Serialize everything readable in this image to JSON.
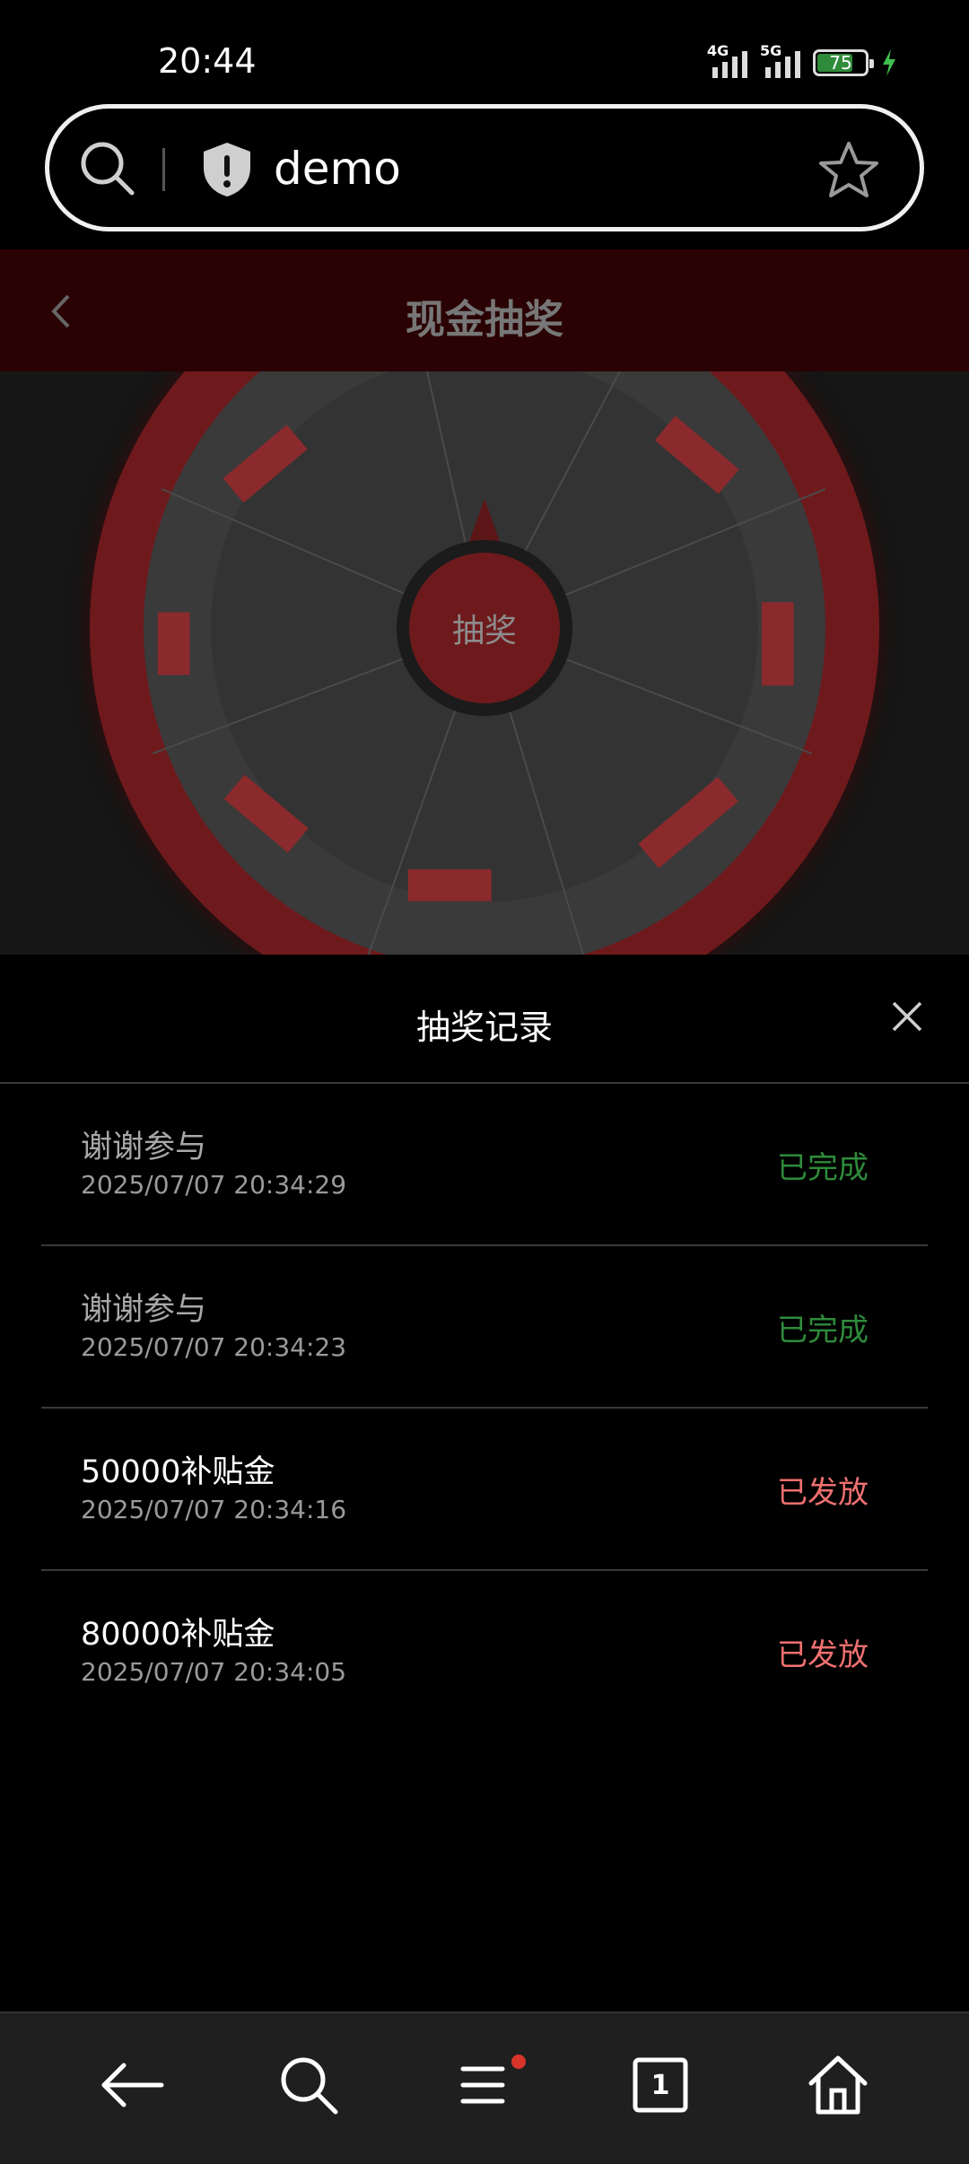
{
  "status_bar": {
    "time": "20:44",
    "network_1": "4G",
    "network_2": "5G",
    "battery": "75",
    "battery_color": "#2f8a3a"
  },
  "url_bar": {
    "domain": "demo",
    "icons": [
      "search-icon",
      "shield-warning-icon",
      "star-icon"
    ]
  },
  "page": {
    "title": "现金抽奖",
    "spin_button": "抽奖",
    "accent_color": "#6e1a1d"
  },
  "sheet": {
    "title": "抽奖记录",
    "records": [
      {
        "name": "谢谢参与",
        "time": "2025/07/07 20:34:29",
        "status": "已完成"
      },
      {
        "name": "谢谢参与",
        "time": "2025/07/07 20:34:23",
        "status": "已完成"
      },
      {
        "name": "50000补贴金",
        "time": "2025/07/07 20:34:16",
        "status": "已发放"
      },
      {
        "name": "80000补贴金",
        "time": "2025/07/07 20:34:05",
        "status": "已发放"
      }
    ],
    "colors": {
      "done": "#2e8b3a",
      "issued": "#f07070",
      "muted_name": "#a8a8a8",
      "highlight_name": "#ffffff"
    }
  },
  "bottom_nav": {
    "tab_count": "1",
    "notification_color": "#d9342b",
    "icons": [
      "back-arrow-icon",
      "search-icon",
      "menu-icon",
      "tabs-icon",
      "home-icon"
    ]
  }
}
